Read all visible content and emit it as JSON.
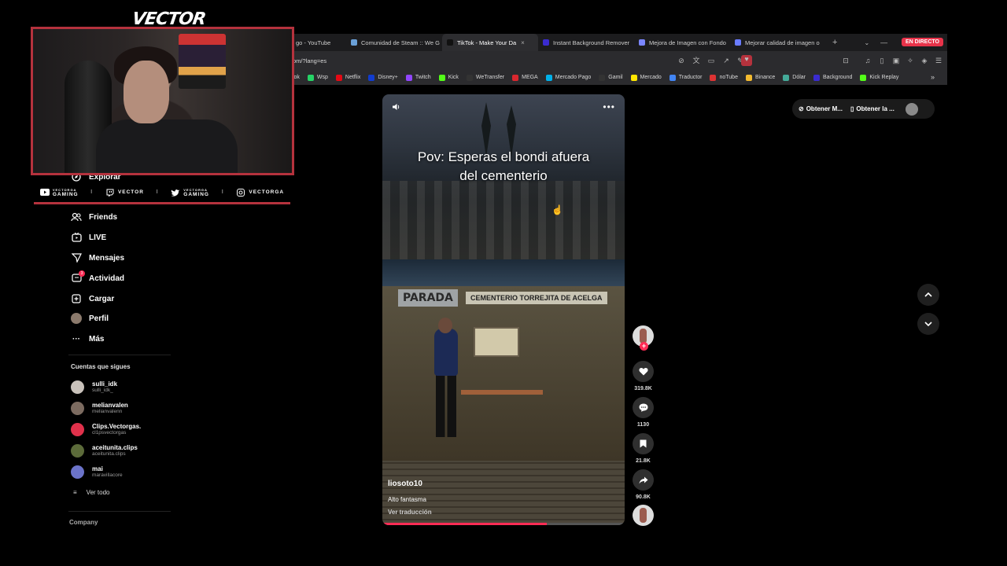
{
  "overlay": {
    "logo_text": "VECTOR",
    "socials": [
      {
        "icon": "youtube-icon",
        "label_top": "VECTORGA",
        "label": "GAMING"
      },
      {
        "icon": "twitch-icon",
        "label": "VECTOR"
      },
      {
        "icon": "twitter-icon",
        "label_top": "VECTORGA",
        "label": "GAMING"
      },
      {
        "icon": "instagram-icon",
        "label": "VECTORGA"
      }
    ]
  },
  "browser": {
    "tabs": [
      {
        "label": "go - YouTube",
        "color": "#e33"
      },
      {
        "label": "Comunidad de Steam :: We G",
        "color": "#6aa0d8"
      },
      {
        "label": "TikTok - Make Your Da",
        "color": "#111",
        "active": true
      },
      {
        "label": "Instant Background Remover",
        "color": "#3a2bd0"
      },
      {
        "label": "Mejora de Imagen con Fondo",
        "color": "#7a86ff"
      },
      {
        "label": "Mejorar calidad de imagen o",
        "color": "#6a7cff"
      }
    ],
    "live_badge": "EN DIRECTO",
    "new_tab": "+",
    "url": "om/?lang=es",
    "bookmarks": [
      {
        "label": "Tok",
        "color": "#222"
      },
      {
        "label": "Wsp",
        "color": "#25d366"
      },
      {
        "label": "Netflix",
        "color": "#e50914"
      },
      {
        "label": "Disney+",
        "color": "#113ccf"
      },
      {
        "label": "Twitch",
        "color": "#9146ff"
      },
      {
        "label": "Kick",
        "color": "#53fc18"
      },
      {
        "label": "WeTransfer",
        "color": "#333"
      },
      {
        "label": "MEGA",
        "color": "#d9272e"
      },
      {
        "label": "Mercado Pago",
        "color": "#00b1ea"
      },
      {
        "label": "Gamil",
        "color": "#333"
      },
      {
        "label": "Mercado",
        "color": "#ffe600"
      },
      {
        "label": "Traductor",
        "color": "#4285f4"
      },
      {
        "label": "noTube",
        "color": "#d33"
      },
      {
        "label": "Binance",
        "color": "#f3ba2f"
      },
      {
        "label": "Dólar",
        "color": "#4a9"
      },
      {
        "label": "Background",
        "color": "#3a2bd0"
      },
      {
        "label": "Kick Replay",
        "color": "#53fc18"
      }
    ],
    "bookmarks_more": "»"
  },
  "sidebar": {
    "items": [
      {
        "label": "Explorar",
        "icon": "compass-icon"
      },
      {
        "label": "Friends",
        "icon": "friends-icon"
      },
      {
        "label": "LIVE",
        "icon": "live-icon"
      },
      {
        "label": "Mensajes",
        "icon": "messages-icon"
      },
      {
        "label": "Actividad",
        "icon": "activity-icon",
        "badge": "3"
      },
      {
        "label": "Cargar",
        "icon": "upload-icon"
      },
      {
        "label": "Perfil",
        "icon": "profile-icon"
      },
      {
        "label": "Más",
        "icon": "more-icon"
      }
    ],
    "following_title": "Cuentas que sigues",
    "accounts": [
      {
        "name": "sulli_idk",
        "handle": "sulli_idk_",
        "color": "#c9c2bb"
      },
      {
        "name": "melianvalen",
        "handle": "melianvalenn",
        "color": "#7c6b60"
      },
      {
        "name": "Clips.Vectorgas.",
        "handle": "cl1psvectorgas",
        "color": "#e0314b"
      },
      {
        "name": "aceitunita.clips",
        "handle": "aceitunita.clips",
        "color": "#5c6b3a"
      },
      {
        "name": "mai",
        "handle": "maravillacore",
        "color": "#6b73c9"
      }
    ],
    "see_all": "Ver todo",
    "company": "Company"
  },
  "video": {
    "caption_line1": "Pov: Esperas el bondi afuera",
    "caption_line2": "del cementerio",
    "sign_left": "PARADA",
    "sign_right": "CEMENTERIO TORREJITA DE ACELGA",
    "author": "liosoto10",
    "description": "Alto fantasma",
    "translate": "Ver traducción",
    "progress": 0.68
  },
  "actions": {
    "likes": "319.8K",
    "comments": "1130",
    "saves": "21.8K",
    "shares": "90.8K"
  },
  "topright": {
    "pill1": "Obtener M...",
    "pill2": "Obtener la ..."
  }
}
